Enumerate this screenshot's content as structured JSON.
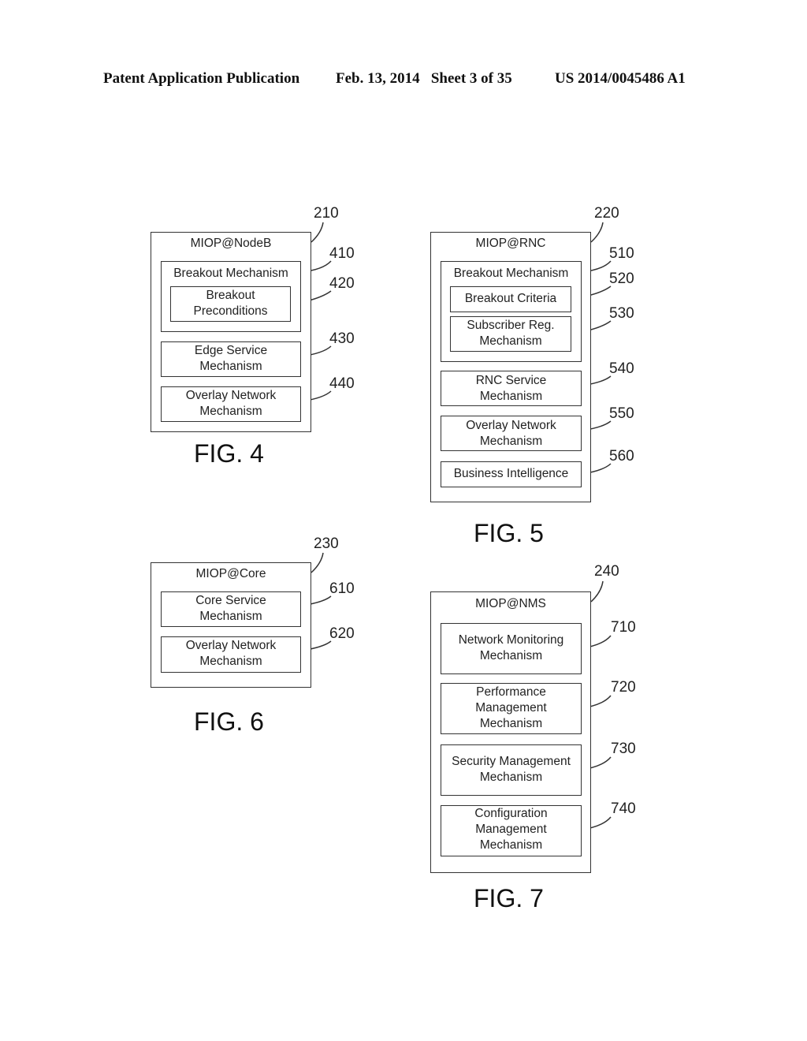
{
  "header": {
    "publication": "Patent Application Publication",
    "date_sheet": "Feb. 13, 2014   Sheet 3 of 35",
    "number": "US 2014/0045486 A1"
  },
  "figures": {
    "fig4": {
      "caption": "FIG. 4",
      "ref": "210",
      "title": "MIOP@NodeB",
      "breakout": {
        "ref": "410",
        "label": "Breakout Mechanism",
        "inner": [
          {
            "ref": "420",
            "lines": [
              "Breakout",
              "Preconditions"
            ]
          }
        ]
      },
      "blocks": [
        {
          "ref": "430",
          "lines": [
            "Edge Service",
            "Mechanism"
          ]
        },
        {
          "ref": "440",
          "lines": [
            "Overlay Network",
            "Mechanism"
          ]
        }
      ]
    },
    "fig5": {
      "caption": "FIG. 5",
      "ref": "220",
      "title": "MIOP@RNC",
      "breakout": {
        "ref": "510",
        "label": "Breakout Mechanism",
        "inner": [
          {
            "ref": "520",
            "lines": [
              "Breakout Criteria"
            ]
          },
          {
            "ref": "530",
            "lines": [
              "Subscriber Reg.",
              "Mechanism"
            ]
          }
        ]
      },
      "blocks": [
        {
          "ref": "540",
          "lines": [
            "RNC Service",
            "Mechanism"
          ]
        },
        {
          "ref": "550",
          "lines": [
            "Overlay Network",
            "Mechanism"
          ]
        },
        {
          "ref": "560",
          "lines": [
            "Business Intelligence"
          ]
        }
      ]
    },
    "fig6": {
      "caption": "FIG. 6",
      "ref": "230",
      "title": "MIOP@Core",
      "blocks": [
        {
          "ref": "610",
          "lines": [
            "Core Service",
            "Mechanism"
          ]
        },
        {
          "ref": "620",
          "lines": [
            "Overlay Network",
            "Mechanism"
          ]
        }
      ]
    },
    "fig7": {
      "caption": "FIG. 7",
      "ref": "240",
      "title": "MIOP@NMS",
      "blocks": [
        {
          "ref": "710",
          "lines": [
            "Network Monitoring",
            "Mechanism"
          ]
        },
        {
          "ref": "720",
          "lines": [
            "Performance",
            "Management",
            "Mechanism"
          ]
        },
        {
          "ref": "730",
          "lines": [
            "Security Management",
            "Mechanism"
          ]
        },
        {
          "ref": "740",
          "lines": [
            "Configuration",
            "Management",
            "Mechanism"
          ]
        }
      ]
    }
  }
}
